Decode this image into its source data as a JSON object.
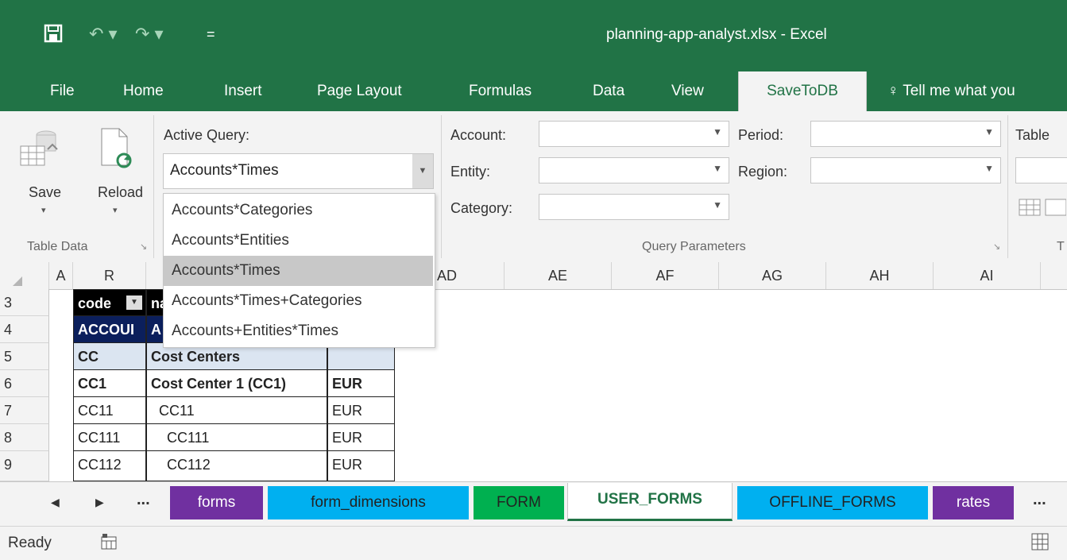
{
  "window": {
    "title": "planning-app-analyst.xlsx  -  Excel",
    "accent": "#217346"
  },
  "qat": {
    "save_icon": "save-icon",
    "undo_icon": "undo-icon",
    "redo_icon": "redo-icon",
    "customize": "="
  },
  "tabs": [
    {
      "label": "File"
    },
    {
      "label": "Home"
    },
    {
      "label": "Insert"
    },
    {
      "label": "Page Layout"
    },
    {
      "label": "Formulas"
    },
    {
      "label": "Data"
    },
    {
      "label": "View"
    },
    {
      "label": "SaveToDB"
    }
  ],
  "tell_me": "Tell me what you",
  "ribbon": {
    "save_label": "Save",
    "reload_label": "Reload",
    "table_data_group": "Table Data",
    "active_query_label": "Active Query:",
    "active_query_value": "Accounts*Times",
    "params": {
      "account": "Account:",
      "entity": "Entity:",
      "category": "Category:",
      "period": "Period:",
      "region": "Region:",
      "table": "Table"
    },
    "query_params_group": "Query Parameters",
    "partial_group": "T"
  },
  "dropdown": {
    "items": [
      "Accounts*Categories",
      "Accounts*Entities",
      "Accounts*Times",
      "Accounts*Times+Categories",
      "Accounts+Entities*Times"
    ],
    "selected_index": 2
  },
  "columns": [
    "A",
    "R",
    "AD",
    "AE",
    "AF",
    "AG",
    "AH",
    "AI"
  ],
  "rows": [
    "3",
    "4",
    "5",
    "6",
    "7",
    "8",
    "9"
  ],
  "table": {
    "header": [
      "code",
      "na"
    ],
    "r4": [
      "ACCOUI",
      "A"
    ],
    "r5": [
      "CC",
      "Cost Centers",
      ""
    ],
    "r6": [
      "CC1",
      "Cost Center 1 (CC1)",
      "EUR"
    ],
    "r7": [
      "CC11",
      "  CC11",
      "EUR"
    ],
    "r8": [
      "CC111",
      "    CC111",
      "EUR"
    ],
    "r9": [
      "CC112",
      "    CC112",
      "EUR"
    ]
  },
  "sheets": [
    {
      "label": "forms",
      "color": "#7030a0"
    },
    {
      "label": "form_dimensions",
      "color": "#00b0f0"
    },
    {
      "label": "FORM",
      "color": "#00b050"
    },
    {
      "label": "USER_FORMS",
      "color": "#ffffff"
    },
    {
      "label": "OFFLINE_FORMS",
      "color": "#00b0f0"
    },
    {
      "label": "rates",
      "color": "#7030a0"
    }
  ],
  "sheet_nav": {
    "prev": "◀",
    "next": "▶",
    "more_left": "...",
    "more_right": "..."
  },
  "status": {
    "text": "Ready"
  }
}
